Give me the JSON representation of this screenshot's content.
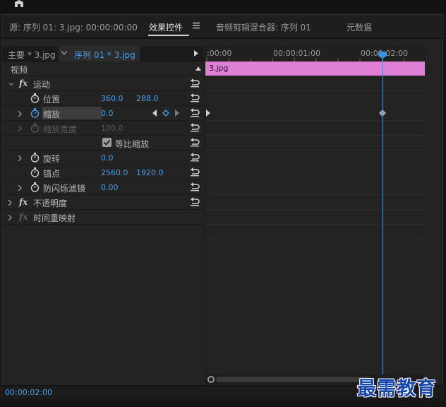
{
  "tabs": {
    "source": "源: 序列 01: 3.jpg: 00:00:00:00",
    "effect_controls": "效果控件",
    "audio_mixer": "音频剪辑混合器: 序列 01",
    "metadata": "元数据"
  },
  "sequence_bar": {
    "master": "主要 * 3.jpg",
    "sequence": "序列 01 * 3.jpg"
  },
  "ruler": {
    "labels": [
      ":00:00",
      "00:00:01:00",
      "00:00:02:00"
    ]
  },
  "clip": {
    "name": "3.jpg",
    "color": "#e07fd6"
  },
  "rows": {
    "video": "视频",
    "motion": "运动",
    "position": {
      "label": "位置",
      "x": "360.0",
      "y": "288.0"
    },
    "scale": {
      "label": "缩放",
      "value": "0.0"
    },
    "scale_width": {
      "label": "缩放宽度",
      "value": "100.0"
    },
    "uniform_scale": {
      "label": "等比缩放",
      "checked": true
    },
    "rotation": {
      "label": "旋转",
      "value": "0.0"
    },
    "anchor": {
      "label": "锚点",
      "x": "2560.0",
      "y": "1920.0"
    },
    "anti_flicker": {
      "label": "防闪烁滤镜",
      "value": "0.00"
    },
    "opacity": "不透明度",
    "time_remap": "时间重映射",
    "fx": "fx"
  },
  "footer": {
    "timecode": "00:00:02:00"
  },
  "watermark": "最需教育",
  "colors": {
    "accent": "#4a9ee8",
    "playhead": "#3d8fe0",
    "clip": "#e07fd6"
  }
}
